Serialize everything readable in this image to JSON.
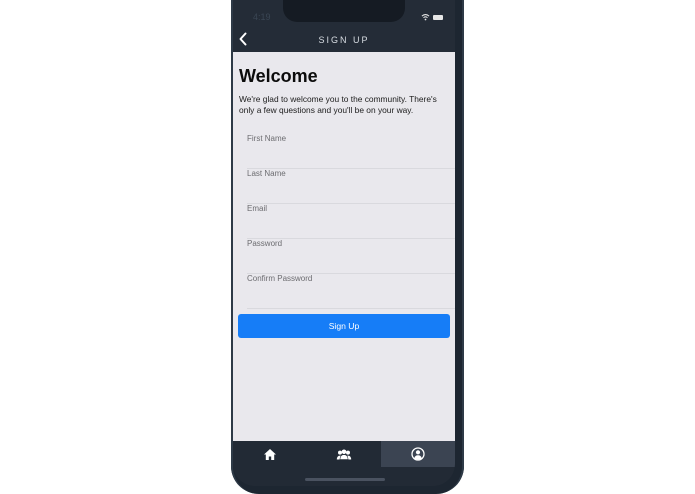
{
  "status_bar": {
    "time": "4:19"
  },
  "header": {
    "title": "SIGN UP"
  },
  "main": {
    "title": "Welcome",
    "intro": "We're glad to welcome you to the community. There's only a few questions and you'll be on your way.",
    "fields": [
      {
        "label": "First Name",
        "value": ""
      },
      {
        "label": "Last Name",
        "value": ""
      },
      {
        "label": "Email",
        "value": ""
      },
      {
        "label": "Password",
        "value": ""
      },
      {
        "label": "Confirm Password",
        "value": ""
      }
    ],
    "submit_label": "Sign Up"
  },
  "tabbar": {
    "items": [
      {
        "icon": "home-icon",
        "active": false
      },
      {
        "icon": "group-icon",
        "active": false
      },
      {
        "icon": "profile-icon",
        "active": true
      }
    ]
  },
  "colors": {
    "accent": "#167df7",
    "screen_bg": "#e9e8ed",
    "bar_bg": "#242c37"
  }
}
